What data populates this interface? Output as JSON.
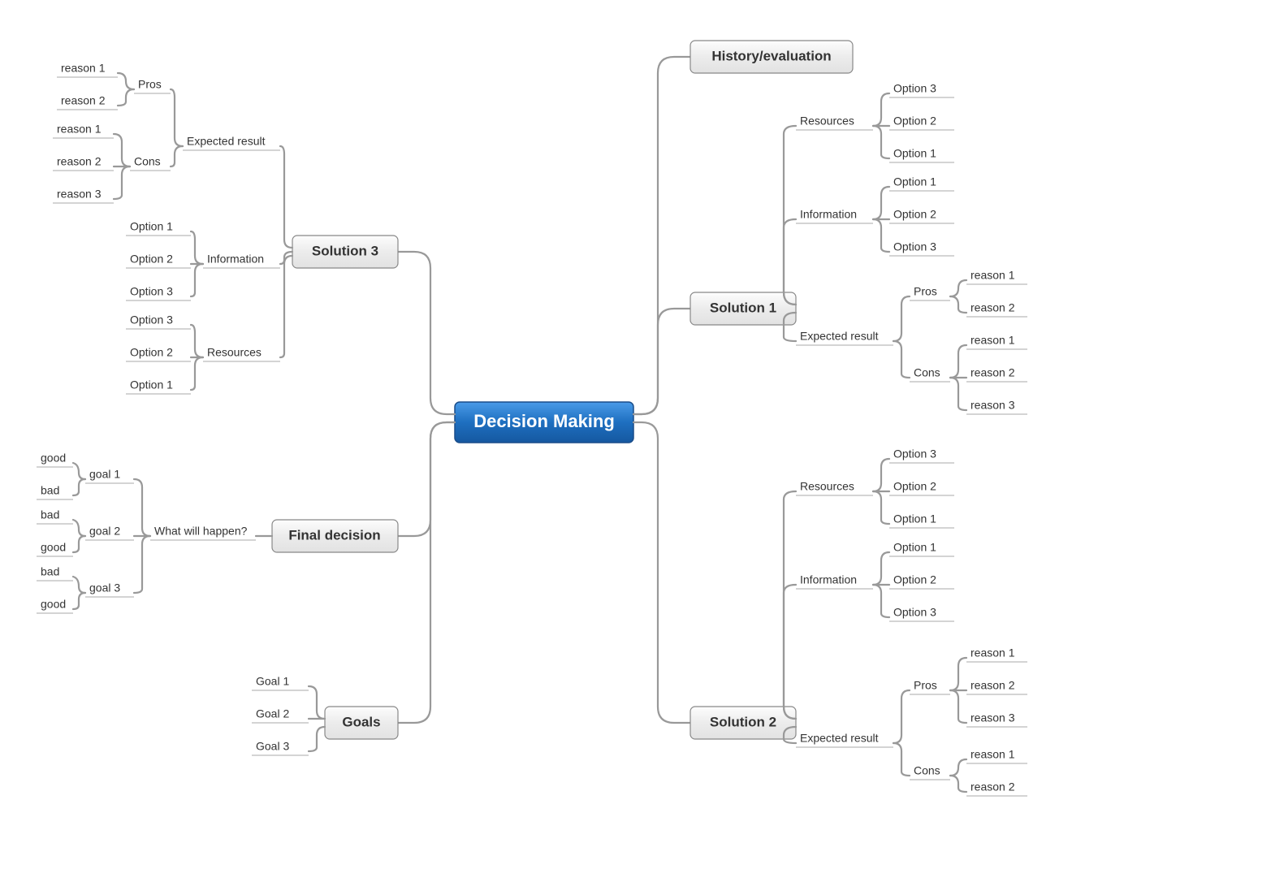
{
  "root": "Decision Making",
  "branches": {
    "history": "History/evaluation",
    "solution1": "Solution 1",
    "solution2": "Solution 2",
    "solution3": "Solution 3",
    "finalDecision": "Final decision",
    "goals": "Goals"
  },
  "sub": {
    "resources": "Resources",
    "information": "Information",
    "expectedResult": "Expected result",
    "whatWillHappen": "What will happen?",
    "pros": "Pros",
    "cons": "Cons",
    "option1": "Option 1",
    "option2": "Option 2",
    "option3": "Option 3",
    "reason1": "reason 1",
    "reason2": "reason 2",
    "reason3": "reason 3",
    "goal1": "Goal 1",
    "goal2": "Goal 2",
    "goal3": "Goal 3",
    "g1": "goal 1",
    "g2": "goal 2",
    "g3": "goal 3",
    "good": "good",
    "bad": "bad"
  }
}
